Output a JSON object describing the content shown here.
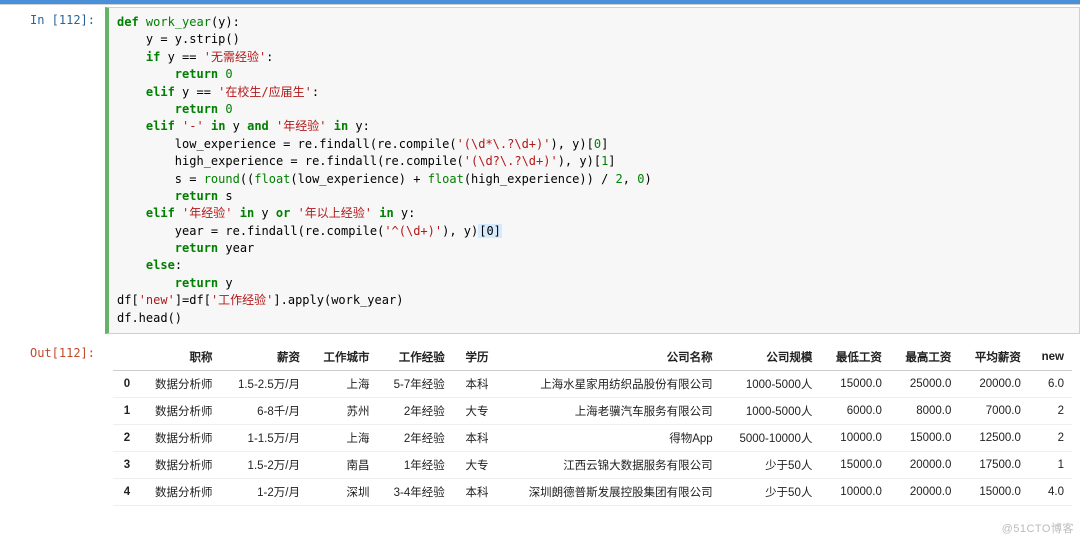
{
  "input": {
    "prompt": "In  [112]:",
    "code_lines": [
      [
        [
          "kw",
          "def"
        ],
        [
          "py",
          " "
        ],
        [
          "fn",
          "work_year"
        ],
        [
          "py",
          "(y):"
        ]
      ],
      [
        [
          "py",
          "    y = y.strip()"
        ]
      ],
      [
        [
          "py",
          "    "
        ],
        [
          "kw",
          "if"
        ],
        [
          "py",
          " y == "
        ],
        [
          "str",
          "'无需经验'"
        ],
        [
          "py",
          ":"
        ]
      ],
      [
        [
          "py",
          "        "
        ],
        [
          "kw",
          "return"
        ],
        [
          "py",
          " "
        ],
        [
          "num",
          "0"
        ]
      ],
      [
        [
          "py",
          "    "
        ],
        [
          "kw",
          "elif"
        ],
        [
          "py",
          " y == "
        ],
        [
          "str",
          "'在校生/应届生'"
        ],
        [
          "py",
          ":"
        ]
      ],
      [
        [
          "py",
          "        "
        ],
        [
          "kw",
          "return"
        ],
        [
          "py",
          " "
        ],
        [
          "num",
          "0"
        ]
      ],
      [
        [
          "py",
          "    "
        ],
        [
          "kw",
          "elif"
        ],
        [
          "py",
          " "
        ],
        [
          "str",
          "'-'"
        ],
        [
          "py",
          " "
        ],
        [
          "kw",
          "in"
        ],
        [
          "py",
          " y "
        ],
        [
          "kw",
          "and"
        ],
        [
          "py",
          " "
        ],
        [
          "str",
          "'年经验'"
        ],
        [
          "py",
          " "
        ],
        [
          "kw",
          "in"
        ],
        [
          "py",
          " y:"
        ]
      ],
      [
        [
          "py",
          "        low_experience = re.findall(re.compile("
        ],
        [
          "str",
          "'(\\d*\\.?\\d+)'"
        ],
        [
          "py",
          "), y)["
        ],
        [
          "num",
          "0"
        ],
        [
          "py",
          "]"
        ]
      ],
      [
        [
          "py",
          "        high_experience = re.findall(re.compile("
        ],
        [
          "str",
          "'(\\d?\\.?\\d+)'"
        ],
        [
          "py",
          "), y)["
        ],
        [
          "num",
          "1"
        ],
        [
          "py",
          "]"
        ]
      ],
      [
        [
          "py",
          "        s = "
        ],
        [
          "fn",
          "round"
        ],
        [
          "py",
          "(("
        ],
        [
          "fn",
          "float"
        ],
        [
          "py",
          "(low_experience) + "
        ],
        [
          "fn",
          "float"
        ],
        [
          "py",
          "(high_experience)) / "
        ],
        [
          "num",
          "2"
        ],
        [
          "py",
          ", "
        ],
        [
          "num",
          "0"
        ],
        [
          "py",
          ")"
        ]
      ],
      [
        [
          "py",
          "        "
        ],
        [
          "kw",
          "return"
        ],
        [
          "py",
          " s"
        ]
      ],
      [
        [
          "py",
          "    "
        ],
        [
          "kw",
          "elif"
        ],
        [
          "py",
          " "
        ],
        [
          "str",
          "'年经验'"
        ],
        [
          "py",
          " "
        ],
        [
          "kw",
          "in"
        ],
        [
          "py",
          " y "
        ],
        [
          "kw",
          "or"
        ],
        [
          "py",
          " "
        ],
        [
          "str",
          "'年以上经验'"
        ],
        [
          "py",
          " "
        ],
        [
          "kw",
          "in"
        ],
        [
          "py",
          " y:"
        ]
      ],
      [
        [
          "py",
          "        year = re.findall(re.compile("
        ],
        [
          "str",
          "'^(\\d+)'"
        ],
        [
          "py",
          "), y)"
        ],
        [
          "hl",
          "[0]"
        ]
      ],
      [
        [
          "py",
          "        "
        ],
        [
          "kw",
          "return"
        ],
        [
          "py",
          " year"
        ]
      ],
      [
        [
          "py",
          "    "
        ],
        [
          "kw",
          "else"
        ],
        [
          "py",
          ":"
        ]
      ],
      [
        [
          "py",
          "        "
        ],
        [
          "kw",
          "return"
        ],
        [
          "py",
          " y"
        ]
      ],
      [
        [
          "py",
          "df["
        ],
        [
          "str",
          "'new'"
        ],
        [
          "py",
          "]=df["
        ],
        [
          "str",
          "'工作经验'"
        ],
        [
          "py",
          "].apply(work_year)"
        ]
      ],
      [
        [
          "py",
          "df.head()"
        ]
      ]
    ]
  },
  "output": {
    "prompt": "Out[112]:",
    "columns": [
      "职称",
      "薪资",
      "工作城市",
      "工作经验",
      "学历",
      "公司名称",
      "公司规模",
      "最低工资",
      "最高工资",
      "平均薪资",
      "new"
    ],
    "rows": [
      {
        "idx": "0",
        "cells": [
          "数据分析师",
          "1.5-2.5万/月",
          "上海",
          "5-7年经验",
          "本科",
          "上海水星家用纺织品股份有限公司",
          "1000-5000人",
          "15000.0",
          "25000.0",
          "20000.0",
          "6.0"
        ]
      },
      {
        "idx": "1",
        "cells": [
          "数据分析师",
          "6-8千/月",
          "苏州",
          "2年经验",
          "大专",
          "上海老骥汽车服务有限公司",
          "1000-5000人",
          "6000.0",
          "8000.0",
          "7000.0",
          "2"
        ]
      },
      {
        "idx": "2",
        "cells": [
          "数据分析师",
          "1-1.5万/月",
          "上海",
          "2年经验",
          "本科",
          "得物App",
          "5000-10000人",
          "10000.0",
          "15000.0",
          "12500.0",
          "2"
        ]
      },
      {
        "idx": "3",
        "cells": [
          "数据分析师",
          "1.5-2万/月",
          "南昌",
          "1年经验",
          "大专",
          "江西云锦大数据服务有限公司",
          "少于50人",
          "15000.0",
          "20000.0",
          "17500.0",
          "1"
        ]
      },
      {
        "idx": "4",
        "cells": [
          "数据分析师",
          "1-2万/月",
          "深圳",
          "3-4年经验",
          "本科",
          "深圳朗德普斯发展控股集团有限公司",
          "少于50人",
          "10000.0",
          "20000.0",
          "15000.0",
          "4.0"
        ]
      }
    ]
  },
  "watermark": "@51CTO博客"
}
